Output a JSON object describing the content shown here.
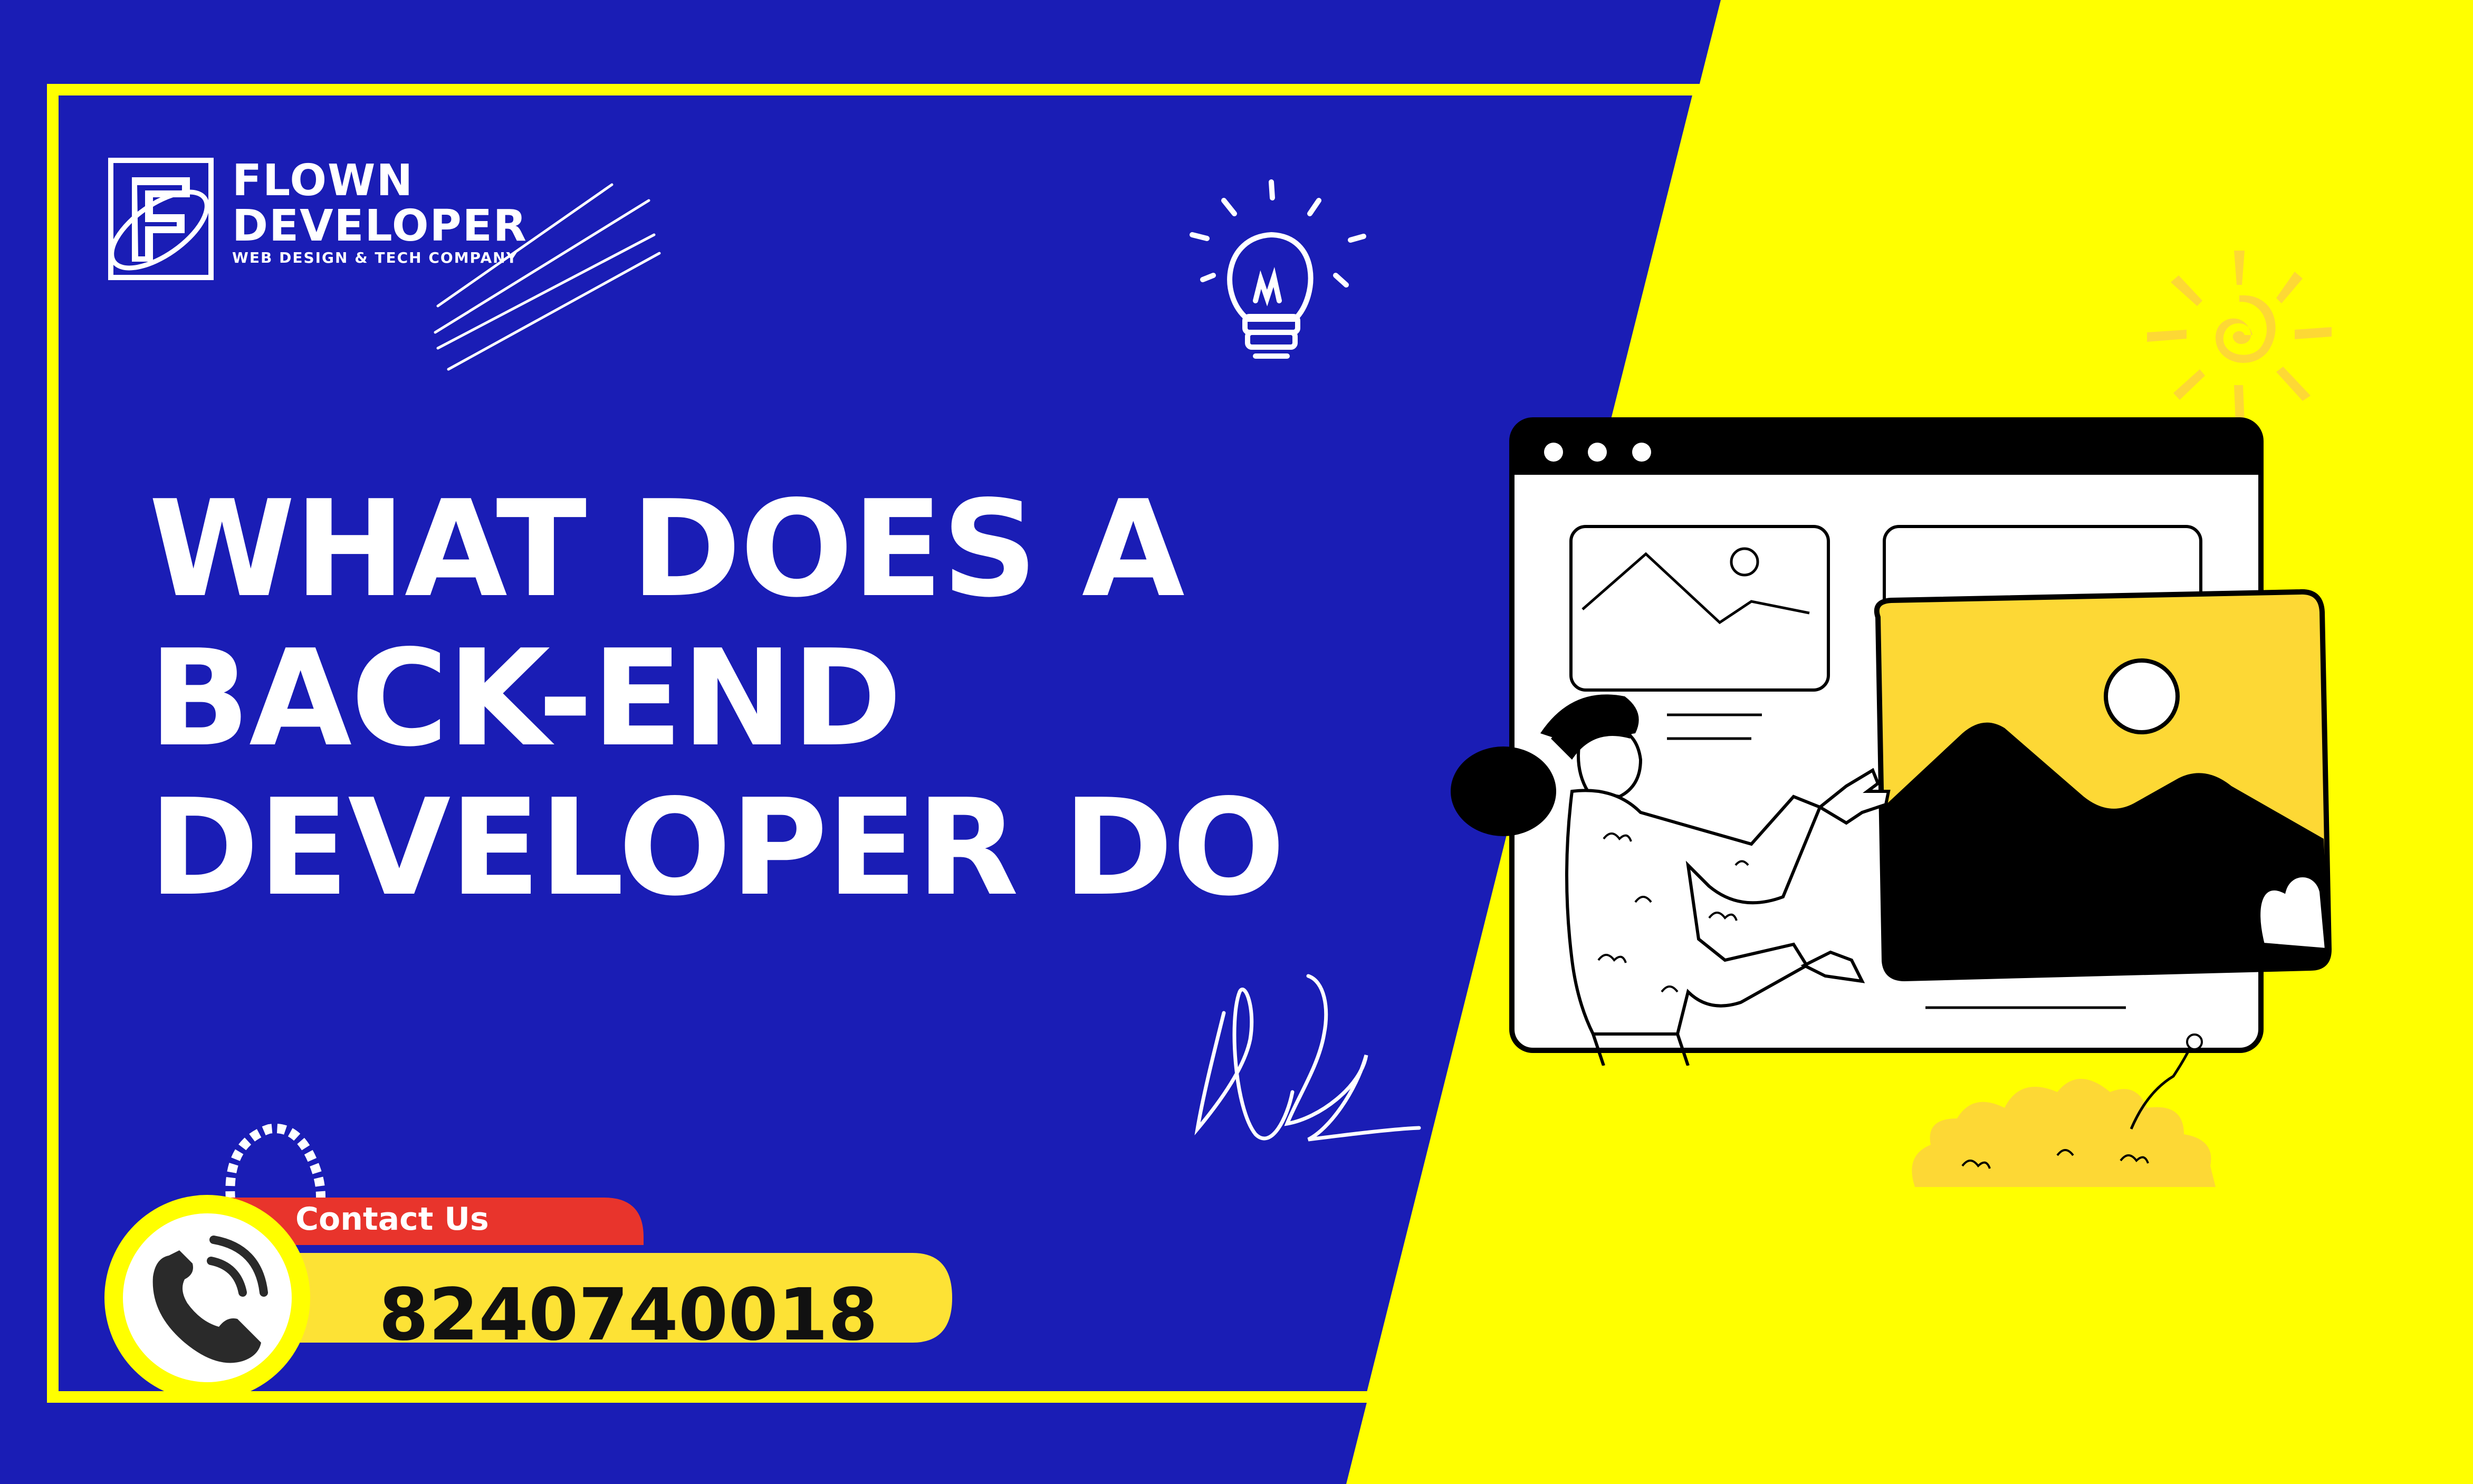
{
  "brand": {
    "name_line1": "FLOWN",
    "name_line2": "DEVELOPER",
    "tagline": "WEB DESIGN & TECH COMPANY",
    "logo_letter": "F"
  },
  "headline": {
    "line1": "WHAT DOES A",
    "line2": "BACK-END",
    "line3": "DEVELOPER DO"
  },
  "contact": {
    "label": "Contact Us",
    "phone": "8240740018",
    "icon": "phone-icon"
  },
  "colors": {
    "blue": "#1A1DB5",
    "yellow": "#FFFF00",
    "contact_red": "#E8342C",
    "pill_yellow": "#FDE235",
    "illustration_yellow": "#FDD835",
    "black": "#000000",
    "white": "#FFFFFF"
  },
  "decorations": [
    "lightbulb-icon",
    "sun-icon",
    "scribble-lines",
    "signature-scribble",
    "browser-window-illustration",
    "woman-presenting-illustration",
    "bush-illustration"
  ]
}
